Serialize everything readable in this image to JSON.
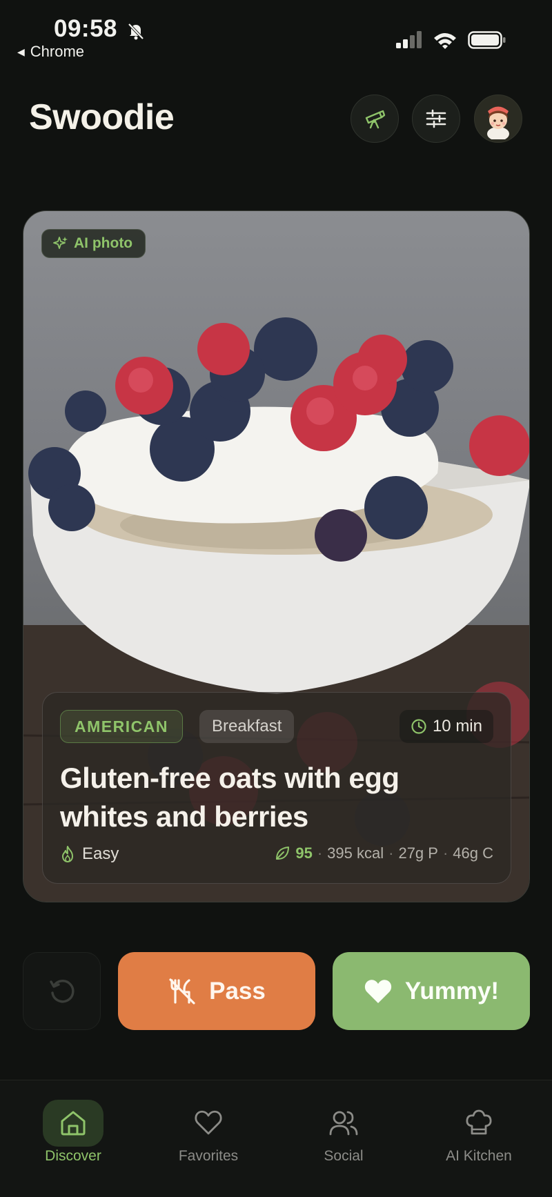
{
  "status_bar": {
    "time": "09:58",
    "back_label": "Chrome",
    "icons": [
      "bell-off-icon",
      "signal-icon",
      "wifi-icon",
      "battery-icon"
    ]
  },
  "header": {
    "title": "Swoodie",
    "buttons": [
      "telescope-icon",
      "sliders-icon",
      "avatar"
    ]
  },
  "card": {
    "badge": "AI photo",
    "cuisine": "AMERICAN",
    "meal_type": "Breakfast",
    "time": "10 min",
    "title": "Gluten-free oats with egg whites and berries",
    "difficulty": "Easy",
    "score": "95",
    "kcal": "395 kcal",
    "protein": "27g P",
    "carbs": "46g C"
  },
  "actions": {
    "pass_label": "Pass",
    "yummy_label": "Yummy!"
  },
  "nav": {
    "items": [
      {
        "label": "Discover",
        "icon": "home-icon",
        "active": true
      },
      {
        "label": "Favorites",
        "icon": "heart-outline-icon",
        "active": false
      },
      {
        "label": "Social",
        "icon": "users-icon",
        "active": false
      },
      {
        "label": "AI Kitchen",
        "icon": "chef-hat-icon",
        "active": false
      }
    ]
  },
  "colors": {
    "background": "#101210",
    "accent_green": "#8fc46a",
    "pass_orange": "#e07d45",
    "yummy_green": "#8bb970"
  }
}
